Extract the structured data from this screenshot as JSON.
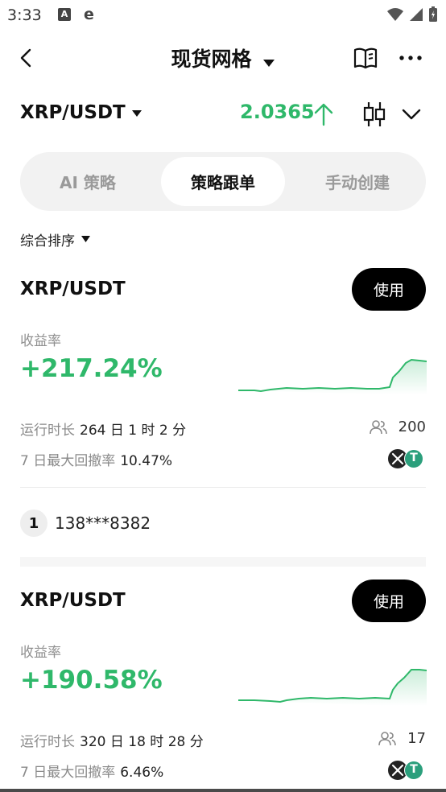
{
  "status_bar": {
    "time": "3:33",
    "icon_a": "A",
    "icon_e": "e"
  },
  "nav": {
    "title": "现货网格"
  },
  "pair": {
    "name": "XRP/USDT",
    "price": "2.0365",
    "price_color": "#2fb86a"
  },
  "tabs": [
    {
      "label": "AI 策略",
      "active": false
    },
    {
      "label": "策略跟单",
      "active": true
    },
    {
      "label": "手动创建",
      "active": false
    }
  ],
  "sort": {
    "label": "综合排序"
  },
  "cards": [
    {
      "pair": "XRP/USDT",
      "use_label": "使用",
      "yield_label": "收益率",
      "yield_value": "+217.24%",
      "runtime_label": "运行时长",
      "runtime_value": "264 日 1 时 2 分",
      "drawdown_label": "7 日最大回撤率",
      "drawdown_value": "10.47%",
      "followers": "200",
      "coin_b": "T"
    },
    {
      "pair": "XRP/USDT",
      "use_label": "使用",
      "yield_label": "收益率",
      "yield_value": "+190.58%",
      "runtime_label": "运行时长",
      "runtime_value": "320 日 18 时 28 分",
      "drawdown_label": "7 日最大回撤率",
      "drawdown_value": "6.46%",
      "followers": "17",
      "coin_b": "T"
    }
  ],
  "leader": {
    "rank": "1",
    "user": "138***8382"
  },
  "colors": {
    "accent_green": "#2fb86a",
    "button_black": "#000000",
    "segment_bg": "#f2f2f2"
  },
  "icons": [
    "back-arrow-icon",
    "caret-down-icon",
    "book-icon",
    "more-icon",
    "arrow-up-icon",
    "candlestick-icon",
    "chevron-down-icon",
    "users-icon",
    "xrp-coin-icon",
    "usdt-coin-icon"
  ]
}
